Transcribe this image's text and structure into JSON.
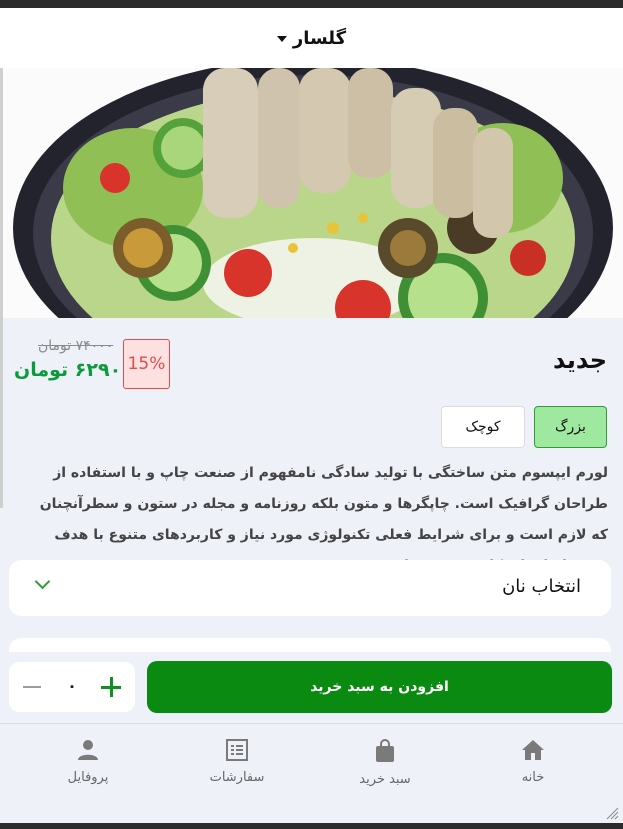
{
  "header": {
    "title": "گلسار"
  },
  "product": {
    "name": "جدید",
    "old_price": "۷۴۰۰۰ تومان",
    "new_price": "۶۲۹۰۰ تومان",
    "discount": "15%",
    "sizes": [
      {
        "label": "بزرگ",
        "selected": true
      },
      {
        "label": "کوچک",
        "selected": false
      }
    ],
    "description": "لورم ایپسوم متن ساختگی با تولید سادگی نامفهوم از صنعت چاپ و با استفاده از طراحان گرافیک است. چاپگرها و متون بلکه روزنامه و مجله در ستون و سطرآنچنان که لازم است و برای شرایط فعلی تکنولوژی مورد نیاز و کاربردهای متنوع با هدف بهبود ابزارهای کاربردی می باشد."
  },
  "bread_select": {
    "label": "انتخاب نان"
  },
  "cart": {
    "quantity": "۰",
    "add_label": "افزودن به سبد خرید"
  },
  "bottom_nav": [
    {
      "label": "خانه",
      "icon": "home-icon"
    },
    {
      "label": "سبد خرید",
      "icon": "shopping-bag-icon"
    },
    {
      "label": "سفارشات",
      "icon": "orders-list-icon"
    },
    {
      "label": "پروفایل",
      "icon": "profile-icon"
    }
  ],
  "colors": {
    "accent_green": "#0a8a10",
    "price_green": "#0d9a3c",
    "discount_red": "#e24b4b",
    "selected_size_bg": "#9fe89f"
  }
}
